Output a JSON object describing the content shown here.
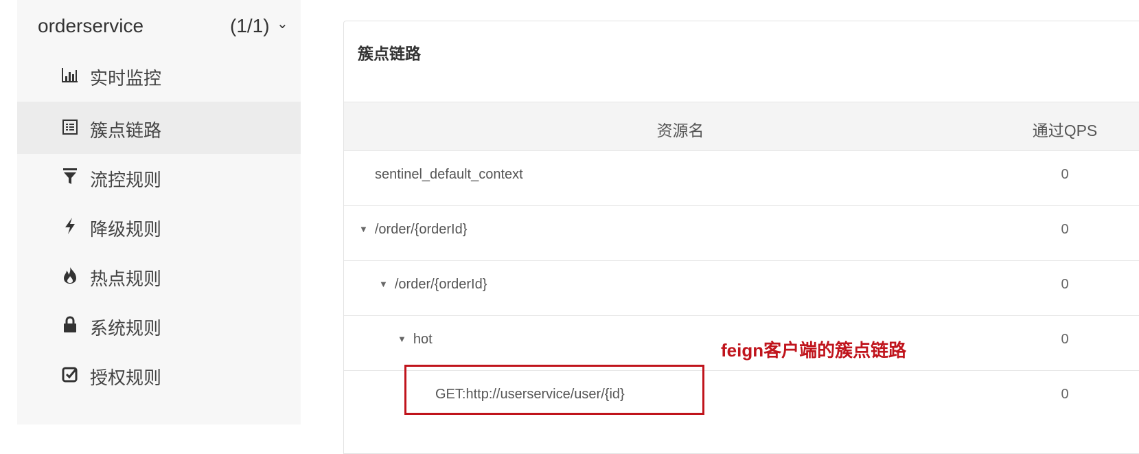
{
  "sidebar": {
    "app": {
      "name": "orderservice",
      "count": "(1/1)",
      "chevron": "⌄"
    },
    "items": [
      {
        "label": "实时监控",
        "icon": "bar-chart-icon"
      },
      {
        "label": "簇点链路",
        "icon": "list-icon",
        "active": true
      },
      {
        "label": "流控规则",
        "icon": "filter-icon"
      },
      {
        "label": "降级规则",
        "icon": "flash-icon"
      },
      {
        "label": "热点规则",
        "icon": "fire-icon"
      },
      {
        "label": "系统规则",
        "icon": "lock-icon"
      },
      {
        "label": "授权规则",
        "icon": "check-square-icon"
      }
    ]
  },
  "panel": {
    "title": "簇点链路",
    "columns": {
      "name": "资源名",
      "qps": "通过QPS"
    },
    "rows": [
      {
        "name": "sentinel_default_context",
        "qps": "0",
        "expandable": false,
        "indent": 0
      },
      {
        "name": "/order/{orderId}",
        "qps": "0",
        "expandable": true,
        "toggle": "▼",
        "indent": 0
      },
      {
        "name": "/order/{orderId}",
        "qps": "0",
        "expandable": true,
        "toggle": "▼",
        "indent": 1
      },
      {
        "name": "hot",
        "qps": "0",
        "expandable": true,
        "toggle": "▼",
        "indent": 2
      },
      {
        "name": "GET:http://userservice/user/{id}",
        "qps": "0",
        "expandable": false,
        "indent": 3
      }
    ]
  },
  "annotation": {
    "text": "feign客户端的簇点链路",
    "color": "#c0141c"
  }
}
